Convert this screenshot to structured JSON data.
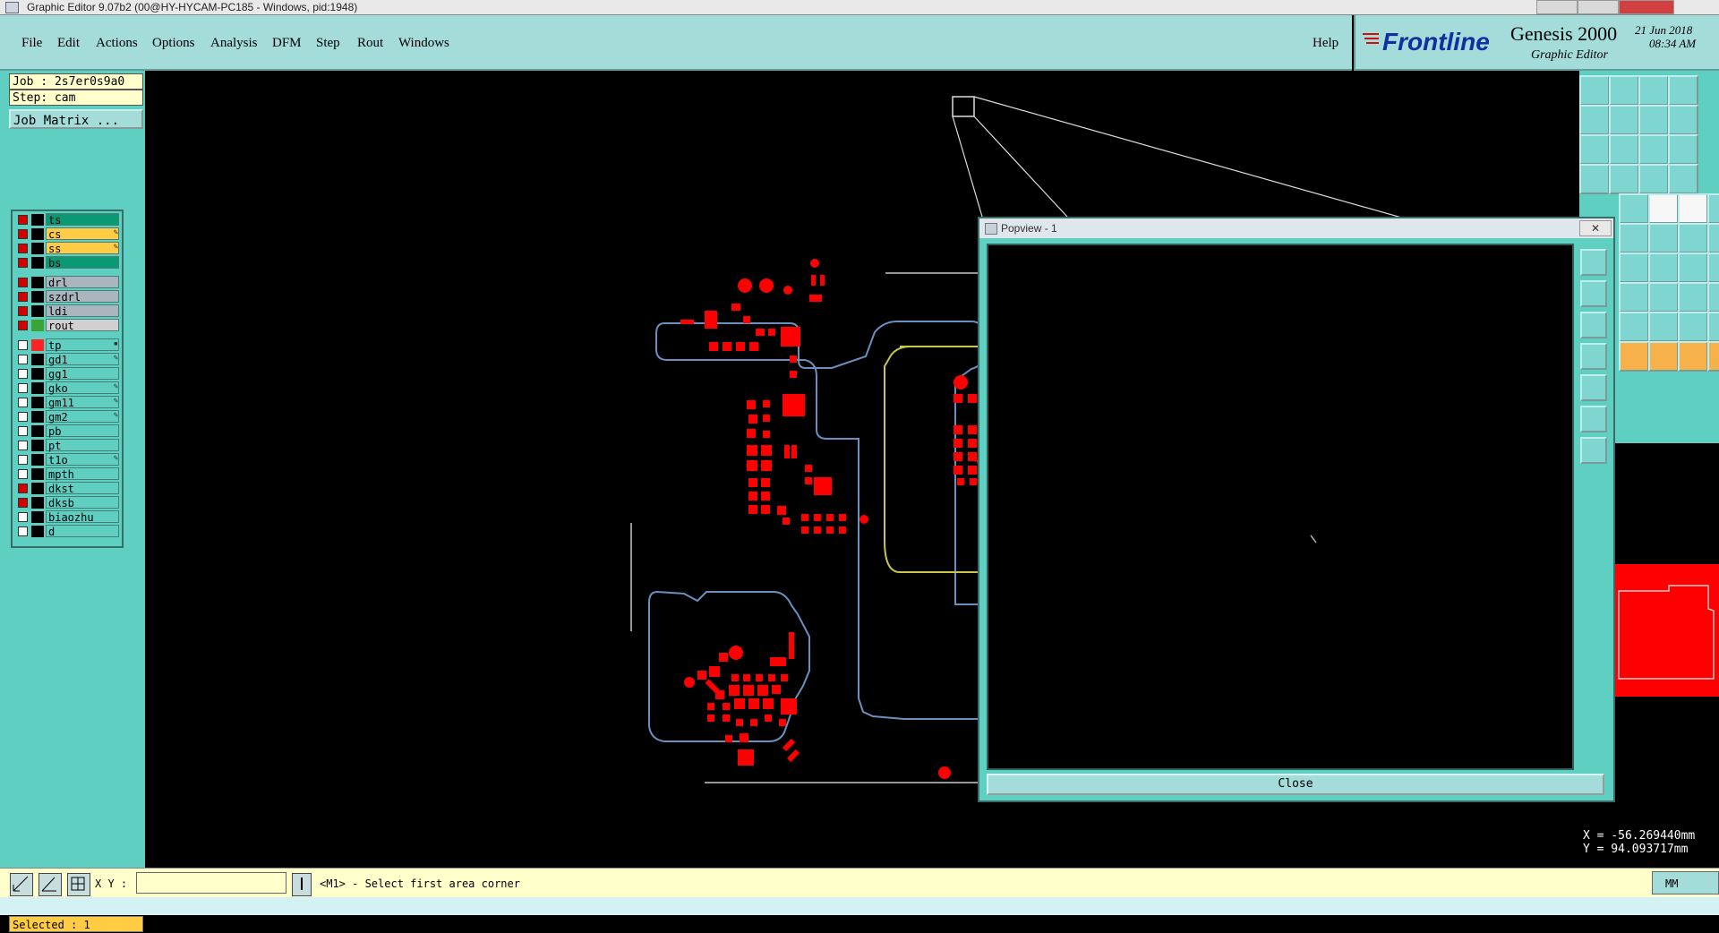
{
  "titlebar": {
    "text": "Graphic Editor 9.07b2 (00@HY-HYCAM-PC185 - Windows, pid:1948)"
  },
  "menu": {
    "items": [
      "File",
      "Edit",
      "Actions",
      "Options",
      "Analysis",
      "DFM",
      "Step",
      "Rout",
      "Windows"
    ],
    "help": "Help"
  },
  "brand": {
    "logo": "Frontline",
    "product": "Genesis 2000",
    "subtitle": "Graphic Editor",
    "date": "21 Jun 2018",
    "time": "08:34 AM"
  },
  "job": {
    "job_line": "Job : 2s7er0s9a0",
    "step_line": "Step: cam",
    "matrix_button": "Job Matrix ..."
  },
  "layers": [
    {
      "name": "ts",
      "checked": true,
      "color": "#000000",
      "bg": "#0a9a73",
      "mark": ""
    },
    {
      "name": "cs",
      "checked": true,
      "color": "#000000",
      "bg": "#ffcc44",
      "mark": "✎"
    },
    {
      "name": "ss",
      "checked": true,
      "color": "#000000",
      "bg": "#ffcc44",
      "mark": "✎"
    },
    {
      "name": "bs",
      "checked": true,
      "color": "#000000",
      "bg": "#0a9a73",
      "mark": ""
    },
    {
      "name": "drl",
      "checked": true,
      "color": "#000000",
      "bg": "#a9b6bd",
      "mark": ""
    },
    {
      "name": "szdrl",
      "checked": true,
      "color": "#000000",
      "bg": "#a9b6bd",
      "mark": ""
    },
    {
      "name": "ldi",
      "checked": true,
      "color": "#000000",
      "bg": "#a9b6bd",
      "mark": ""
    },
    {
      "name": "rout",
      "checked": true,
      "color": "#3aa535",
      "bg": "#d0d0d0",
      "mark": ""
    },
    {
      "name": "tp",
      "checked": false,
      "color": "#ff2222",
      "bg": "#5fcfc2",
      "mark": "▪"
    },
    {
      "name": "gd1",
      "checked": false,
      "color": "#000000",
      "bg": "#5fcfc2",
      "mark": "✎"
    },
    {
      "name": "gg1",
      "checked": false,
      "color": "#000000",
      "bg": "#5fcfc2",
      "mark": ""
    },
    {
      "name": "gko",
      "checked": false,
      "color": "#000000",
      "bg": "#5fcfc2",
      "mark": "✎"
    },
    {
      "name": "gm11",
      "checked": false,
      "color": "#000000",
      "bg": "#5fcfc2",
      "mark": "✎"
    },
    {
      "name": "gm2",
      "checked": false,
      "color": "#000000",
      "bg": "#5fcfc2",
      "mark": "✎"
    },
    {
      "name": "pb",
      "checked": false,
      "color": "#000000",
      "bg": "#5fcfc2",
      "mark": ""
    },
    {
      "name": "pt",
      "checked": false,
      "color": "#000000",
      "bg": "#5fcfc2",
      "mark": ""
    },
    {
      "name": "t1o",
      "checked": false,
      "color": "#000000",
      "bg": "#5fcfc2",
      "mark": "✎"
    },
    {
      "name": "mpth",
      "checked": false,
      "color": "#000000",
      "bg": "#5fcfc2",
      "mark": ""
    },
    {
      "name": "dkst",
      "checked": true,
      "color": "#000000",
      "bg": "#5fcfc2",
      "mark": ""
    },
    {
      "name": "dksb",
      "checked": true,
      "color": "#000000",
      "bg": "#5fcfc2",
      "mark": ""
    },
    {
      "name": "biaozhu",
      "checked": false,
      "color": "#000000",
      "bg": "#5fcfc2",
      "mark": ""
    },
    {
      "name": "d",
      "checked": false,
      "color": "#000000",
      "bg": "#5fcfc2",
      "mark": ""
    }
  ],
  "status": {
    "selected": "Selected : 1"
  },
  "bottom": {
    "xy_label": "X Y :",
    "xy_value": "",
    "prompt": "<M1> - Select first area corner",
    "units": "MM"
  },
  "popview": {
    "title": "Popview - 1",
    "close": "Close"
  },
  "coords": {
    "x": "X = -56.269440mm",
    "y": "Y = 94.093717mm"
  }
}
